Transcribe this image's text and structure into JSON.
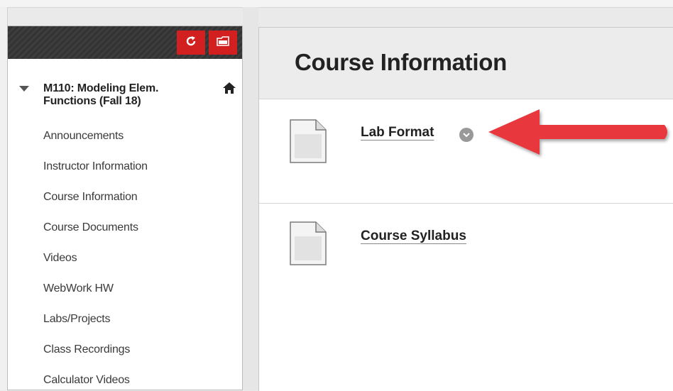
{
  "sidebar": {
    "header": {
      "refresh_icon": "refresh-icon",
      "folder_icon": "folder-view-icon"
    },
    "course_title": "M110: Modeling Elem. Functions (Fall 18)",
    "items": [
      {
        "label": "Announcements"
      },
      {
        "label": "Instructor Information"
      },
      {
        "label": "Course Information"
      },
      {
        "label": "Course Documents"
      },
      {
        "label": "Videos"
      },
      {
        "label": "WebWork HW"
      },
      {
        "label": "Labs/Projects"
      },
      {
        "label": "Class Recordings"
      },
      {
        "label": "Calculator Videos"
      }
    ]
  },
  "main": {
    "title": "Course Information",
    "items": [
      {
        "label": "Lab Format",
        "icon": "document-icon",
        "has_menu": true
      },
      {
        "label": "Course Syllabus",
        "icon": "document-icon",
        "has_menu": false
      }
    ]
  },
  "colors": {
    "accent": "#d21f1f",
    "arrow": "#e8383d",
    "header_bg": "#3b3b3b"
  }
}
